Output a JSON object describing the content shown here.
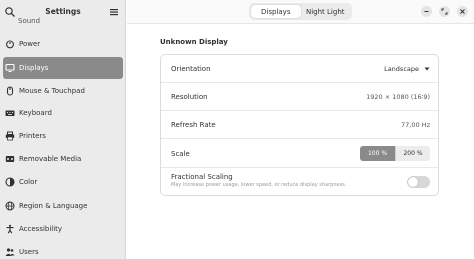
{
  "sidebar": {
    "title": "Settings",
    "partial_item": "Sound",
    "items": [
      {
        "label": "Power",
        "icon": "power-icon"
      },
      {
        "label": "Displays",
        "icon": "display-icon"
      },
      {
        "label": "Mouse & Touchpad",
        "icon": "mouse-icon"
      },
      {
        "label": "Keyboard",
        "icon": "keyboard-icon"
      },
      {
        "label": "Printers",
        "icon": "printer-icon"
      },
      {
        "label": "Removable Media",
        "icon": "media-icon"
      },
      {
        "label": "Color",
        "icon": "color-icon"
      },
      {
        "label": "Region & Language",
        "icon": "globe-icon"
      },
      {
        "label": "Accessibility",
        "icon": "accessibility-icon"
      },
      {
        "label": "Users",
        "icon": "users-icon"
      }
    ],
    "active": "Displays"
  },
  "header": {
    "tabs": [
      {
        "label": "Displays"
      },
      {
        "label": "Night Light"
      }
    ],
    "active_tab": "Displays"
  },
  "display": {
    "section_title": "Unknown Display",
    "orientation": {
      "label": "Orientation",
      "value": "Landscape"
    },
    "resolution": {
      "label": "Resolution",
      "value": "1920 × 1080 (16∶9)"
    },
    "refresh_rate": {
      "label": "Refresh Rate",
      "value": "77,00 Hz"
    },
    "scale": {
      "label": "Scale",
      "options": [
        "100 %",
        "200 %"
      ],
      "selected": "100 %"
    },
    "fractional_scaling": {
      "label": "Fractional Scaling",
      "description": "May increase power usage, lower speed, or reduce display sharpness.",
      "enabled": false
    }
  },
  "colors": {
    "accent_selected": "#8a8a8a",
    "sidebar_bg": "#ebebeb"
  }
}
